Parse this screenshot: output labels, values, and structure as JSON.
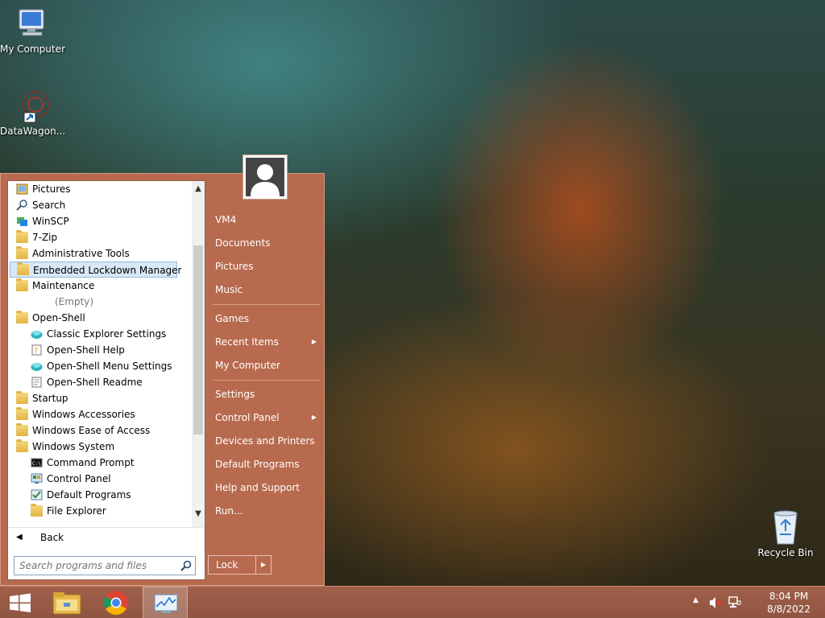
{
  "desktop": {
    "icons": [
      {
        "label": "My Computer"
      },
      {
        "label": "DataWagon..."
      },
      {
        "label": "Recycle Bin"
      }
    ]
  },
  "start_menu": {
    "programs": [
      {
        "label": "Pictures",
        "icon": "pictures-icon"
      },
      {
        "label": "Search",
        "icon": "search-icon"
      },
      {
        "label": "WinSCP",
        "icon": "winscp-icon"
      },
      {
        "label": "7-Zip",
        "icon": "folder-icon"
      },
      {
        "label": "Administrative Tools",
        "icon": "folder-icon"
      },
      {
        "label": "Embedded Lockdown Manager",
        "icon": "folder-icon"
      },
      {
        "label": "Maintenance",
        "icon": "folder-icon"
      },
      {
        "label": "(Empty)"
      },
      {
        "label": "Open-Shell",
        "icon": "folder-icon"
      },
      {
        "label": "Classic Explorer Settings",
        "icon": "shell-icon"
      },
      {
        "label": "Open-Shell Help",
        "icon": "help-icon"
      },
      {
        "label": "Open-Shell Menu Settings",
        "icon": "shell-icon"
      },
      {
        "label": "Open-Shell Readme",
        "icon": "document-icon"
      },
      {
        "label": "Startup",
        "icon": "folder-icon"
      },
      {
        "label": "Windows Accessories",
        "icon": "folder-icon"
      },
      {
        "label": "Windows Ease of Access",
        "icon": "folder-icon"
      },
      {
        "label": "Windows System",
        "icon": "folder-icon"
      },
      {
        "label": "Command Prompt",
        "icon": "cmd-icon"
      },
      {
        "label": "Control Panel",
        "icon": "control-panel-icon"
      },
      {
        "label": "Default Programs",
        "icon": "default-programs-icon"
      },
      {
        "label": "File Explorer",
        "icon": "file-explorer-icon"
      }
    ],
    "back_label": "Back",
    "search_placeholder": "Search programs and files",
    "right_items": [
      {
        "label": "VM4"
      },
      {
        "label": "Documents"
      },
      {
        "label": "Pictures"
      },
      {
        "label": "Music"
      },
      {
        "label": "Games"
      },
      {
        "label": "Recent Items"
      },
      {
        "label": "My Computer"
      },
      {
        "label": "Settings"
      },
      {
        "label": "Control Panel"
      },
      {
        "label": "Devices and Printers"
      },
      {
        "label": "Default Programs"
      },
      {
        "label": "Help and Support"
      },
      {
        "label": "Run..."
      }
    ],
    "lock_label": "Lock"
  },
  "taskbar": {
    "time": "8:04 PM",
    "date": "8/8/2022"
  },
  "colors": {
    "menu_bg": "#b86a4e",
    "taskbar_bg": "#9a5a45",
    "selection": "#d9e8f7"
  }
}
